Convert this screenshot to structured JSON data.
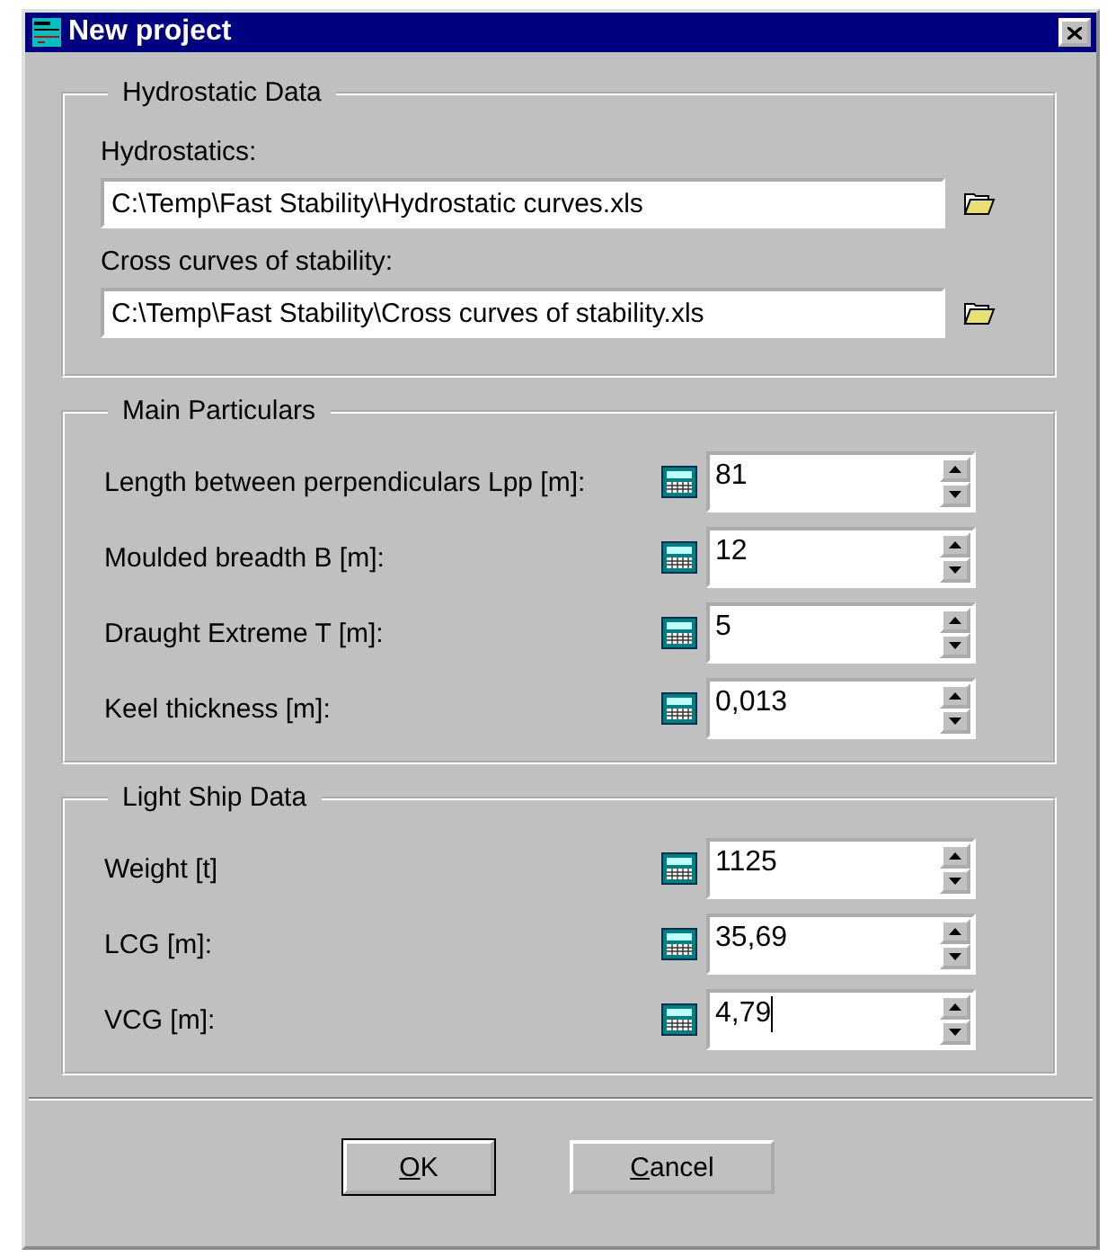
{
  "window": {
    "title": "New project"
  },
  "hydrostatic_data": {
    "title": "Hydrostatic Data",
    "files": [
      {
        "label": "Hydrostatics:",
        "value": "C:\\Temp\\Fast Stability\\Hydrostatic curves.xls"
      },
      {
        "label": "Cross curves of stability:",
        "value": "C:\\Temp\\Fast Stability\\Cross curves of stability.xls"
      }
    ]
  },
  "main_particulars": {
    "title": "Main Particulars",
    "fields": [
      {
        "label": "Length between perpendiculars Lpp [m]:",
        "value": "81",
        "focused": false
      },
      {
        "label": "Moulded breadth B [m]:",
        "value": "12",
        "focused": false
      },
      {
        "label": "Draught Extreme T [m]:",
        "value": "5",
        "focused": false
      },
      {
        "label": "Keel thickness [m]:",
        "value": "0,013",
        "focused": false
      }
    ]
  },
  "light_ship_data": {
    "title": "Light Ship Data",
    "fields": [
      {
        "label": "Weight [t]",
        "value": "1125",
        "focused": false
      },
      {
        "label": "LCG [m]:",
        "value": "35,69",
        "focused": false
      },
      {
        "label": "VCG [m]:",
        "value": "4,79",
        "focused": true
      }
    ]
  },
  "buttons": [
    {
      "label": "OK",
      "first_letter_underlined": true,
      "default": true
    },
    {
      "label": "Cancel",
      "first_letter_underlined": true,
      "default": false
    }
  ]
}
